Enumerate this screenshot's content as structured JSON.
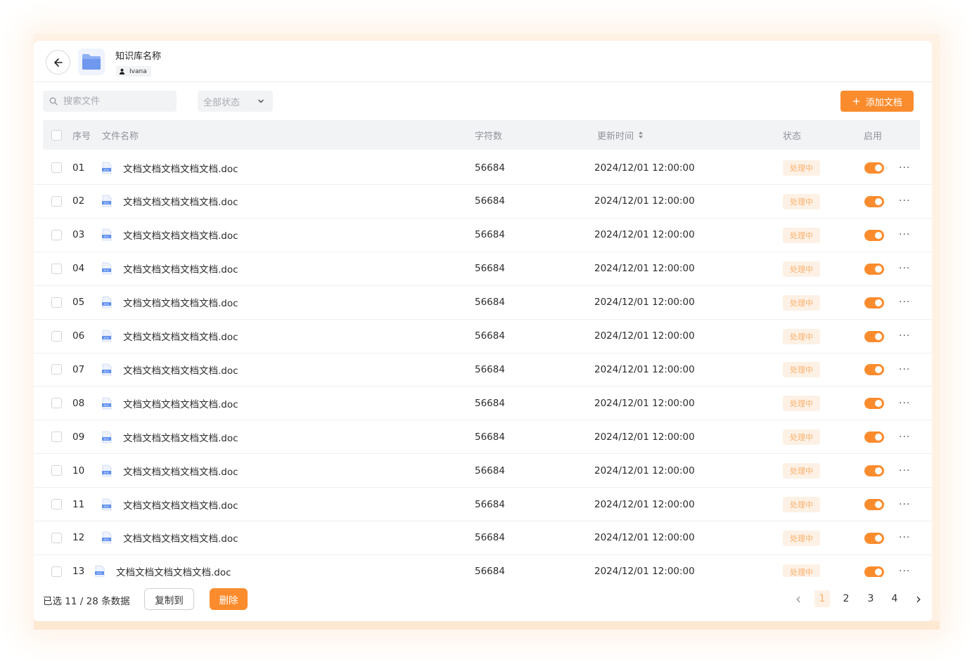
{
  "header": {
    "title": "知识库名称",
    "owner": "Ivana"
  },
  "toolbar": {
    "search_placeholder": "搜索文件",
    "status_filter": "全部状态",
    "add_label": "添加文档",
    "add_icon": "+"
  },
  "table": {
    "columns": {
      "index": "序号",
      "name": "文件名称",
      "chars": "字符数",
      "updated": "更新时间",
      "status": "状态",
      "enabled": "启用"
    },
    "rows": [
      {
        "index": "01",
        "name": "文档文档文档文档文档.doc",
        "chars": "56684",
        "updated": "2024/12/01 12:00:00",
        "status": "处理中",
        "enabled": true
      },
      {
        "index": "02",
        "name": "文档文档文档文档文档.doc",
        "chars": "56684",
        "updated": "2024/12/01 12:00:00",
        "status": "处理中",
        "enabled": true
      },
      {
        "index": "03",
        "name": "文档文档文档文档文档.doc",
        "chars": "56684",
        "updated": "2024/12/01 12:00:00",
        "status": "处理中",
        "enabled": true
      },
      {
        "index": "04",
        "name": "文档文档文档文档文档.doc",
        "chars": "56684",
        "updated": "2024/12/01 12:00:00",
        "status": "处理中",
        "enabled": true
      },
      {
        "index": "05",
        "name": "文档文档文档文档文档.doc",
        "chars": "56684",
        "updated": "2024/12/01 12:00:00",
        "status": "处理中",
        "enabled": true
      },
      {
        "index": "06",
        "name": "文档文档文档文档文档.doc",
        "chars": "56684",
        "updated": "2024/12/01 12:00:00",
        "status": "处理中",
        "enabled": true
      },
      {
        "index": "07",
        "name": "文档文档文档文档文档.doc",
        "chars": "56684",
        "updated": "2024/12/01 12:00:00",
        "status": "处理中",
        "enabled": true
      },
      {
        "index": "08",
        "name": "文档文档文档文档文档.doc",
        "chars": "56684",
        "updated": "2024/12/01 12:00:00",
        "status": "处理中",
        "enabled": true
      },
      {
        "index": "09",
        "name": "文档文档文档文档文档.doc",
        "chars": "56684",
        "updated": "2024/12/01 12:00:00",
        "status": "处理中",
        "enabled": true
      },
      {
        "index": "10",
        "name": "文档文档文档文档文档.doc",
        "chars": "56684",
        "updated": "2024/12/01 12:00:00",
        "status": "处理中",
        "enabled": true
      },
      {
        "index": "11",
        "name": "文档文档文档文档文档.doc",
        "chars": "56684",
        "updated": "2024/12/01 12:00:00",
        "status": "处理中",
        "enabled": true
      },
      {
        "index": "12",
        "name": "文档文档文档文档文档.doc",
        "chars": "56684",
        "updated": "2024/12/01 12:00:00",
        "status": "处理中",
        "enabled": true
      },
      {
        "index": "13",
        "name": "文档文档文档文档文档.doc",
        "chars": "56684",
        "updated": "2024/12/01 12:00:00",
        "status": "处理中",
        "enabled": true
      }
    ],
    "more_label": "···",
    "doc_icon_label": "DOC"
  },
  "footer": {
    "selection_text": "已选 11 / 28 条数据",
    "copy_label": "复制到",
    "delete_label": "删除",
    "pages": [
      "1",
      "2",
      "3",
      "4"
    ],
    "current_page": "1",
    "prev_icon": "‹",
    "next_icon": "›"
  },
  "colors": {
    "accent": "#fb8c2e",
    "badge_bg": "#fdf1e5",
    "badge_text": "#fcb06c",
    "header_bg": "#f2f3f5"
  }
}
